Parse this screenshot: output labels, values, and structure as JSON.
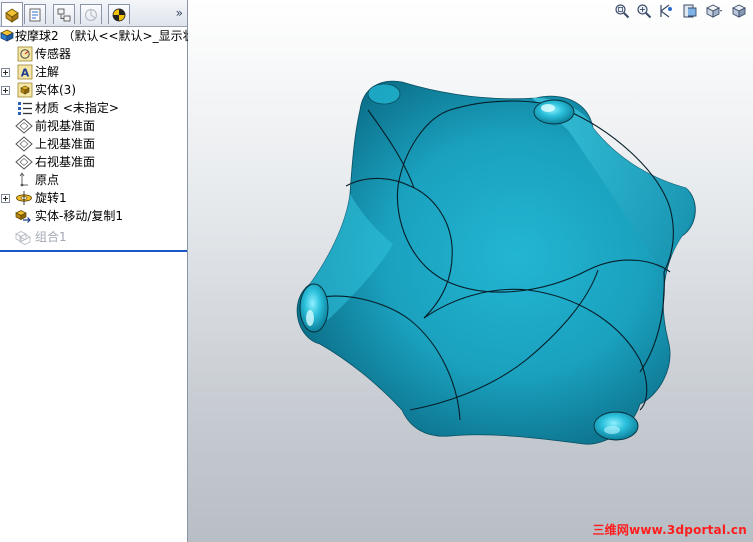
{
  "feature_tree": {
    "root_label": "按摩球2 （默认<<默认>_显示状",
    "items": [
      {
        "label": "传感器",
        "icon": "sensor-icon",
        "expandable": false
      },
      {
        "label": "注解",
        "icon": "annotation-icon",
        "expandable": true
      },
      {
        "label": "实体(3)",
        "icon": "solid-bodies-folder-icon",
        "expandable": true
      },
      {
        "label": "材质 <未指定>",
        "icon": "material-icon",
        "expandable": false
      },
      {
        "label": "前视基准面",
        "icon": "plane-icon",
        "expandable": false
      },
      {
        "label": "上视基准面",
        "icon": "plane-icon",
        "expandable": false
      },
      {
        "label": "右视基准面",
        "icon": "plane-icon",
        "expandable": false
      },
      {
        "label": "原点",
        "icon": "origin-icon",
        "expandable": false
      },
      {
        "label": "旋转1",
        "icon": "revolve-icon",
        "expandable": true
      },
      {
        "label": "实体-移动/复制1",
        "icon": "move-copy-body-icon",
        "expandable": false
      }
    ],
    "suppressed_item": {
      "label": "组合1",
      "icon": "combine-icon"
    }
  },
  "panel_tabs": [
    "feature-manager-tab",
    "property-manager-tab",
    "configuration-manager-tab",
    "dimxpert-tab",
    "display-manager-tab"
  ],
  "panel_expand_glyph": "»",
  "view_toolbar": [
    "zoom-to-fit-icon",
    "zoom-to-area-icon",
    "previous-view-icon",
    "section-view-icon",
    "view-orientation-icon"
  ],
  "watermark": "三维网www.3dportal.cn",
  "colors": {
    "model_fill": "#1ba7c4",
    "model_dark": "#0d6f8a",
    "model_light": "#6fe2f5",
    "rollback_bar": "#1b57c9",
    "watermark": "#ff1e1e"
  }
}
